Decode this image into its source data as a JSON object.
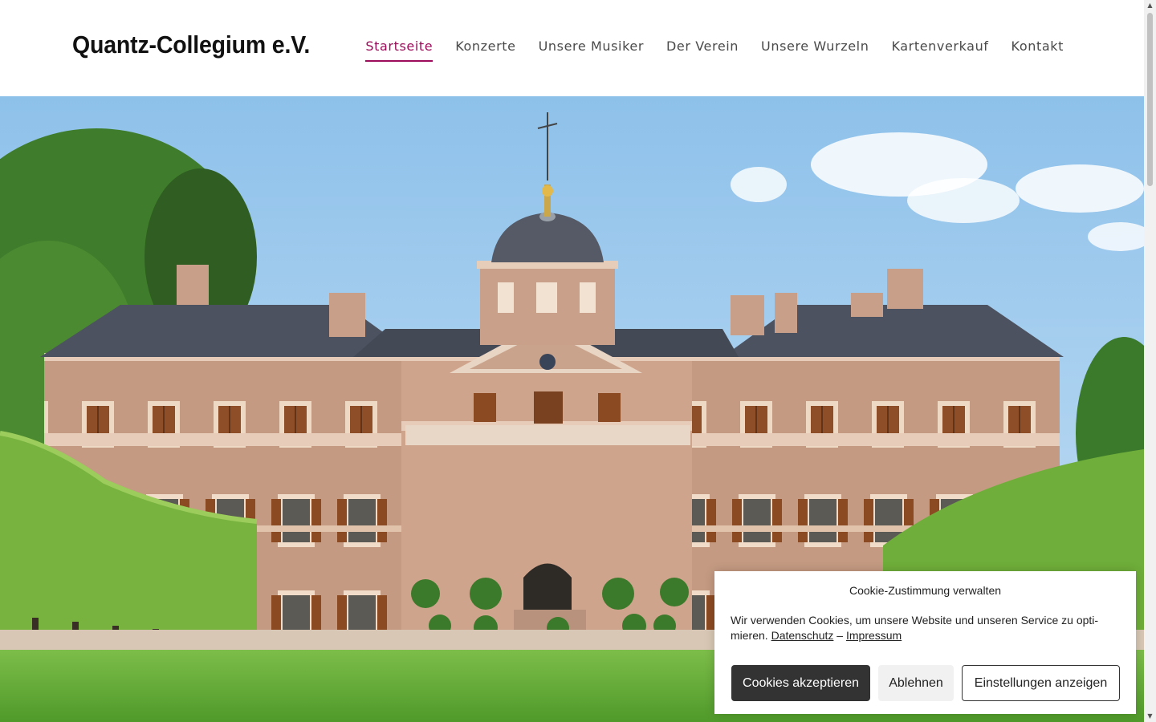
{
  "site": {
    "logo": "Quantz-Collegium e.V."
  },
  "nav": {
    "items": [
      {
        "label": "Startseite",
        "active": true
      },
      {
        "label": "Konzerte"
      },
      {
        "label": "Unsere Musiker"
      },
      {
        "label": "Der Verein"
      },
      {
        "label": "Unsere Wurzeln"
      },
      {
        "label": "Kartenverkauf"
      },
      {
        "label": "Kontakt"
      }
    ],
    "active_color": "#9c0c5a"
  },
  "hero": {
    "image_icon": "baroque-palace-photo"
  },
  "cookie": {
    "title": "Cookie-Zustimmung verwalten",
    "text": "Wir verwenden Cookies, um unsere Website und unseren Service zu opti­mieren.",
    "link_privacy": "Datenschutz",
    "separator": "–",
    "link_imprint": "Impressum",
    "accept": "Cookies akzeptieren",
    "deny": "Ablehnen",
    "settings": "Einstellungen anzeigen"
  }
}
